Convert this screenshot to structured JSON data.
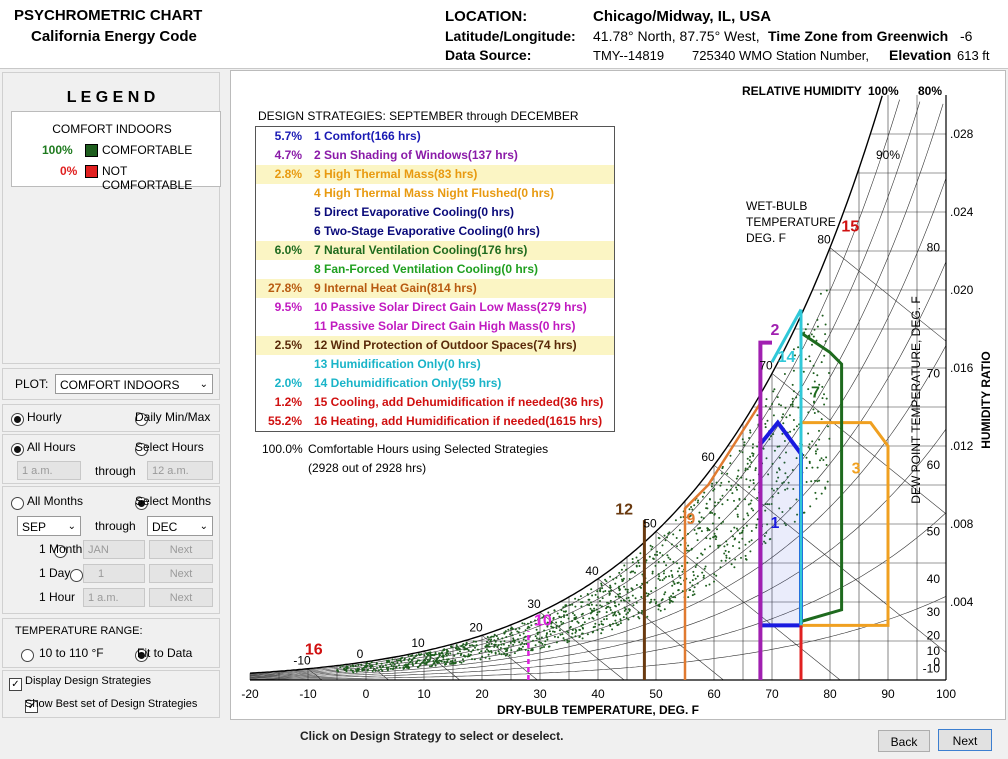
{
  "header": {
    "title1": "PSYCHROMETRIC CHART",
    "title2": "California Energy Code",
    "location_label": "LOCATION:",
    "location_value": "Chicago/Midway, IL, USA",
    "latlon_label": "Latitude/Longitude:",
    "latlon_value": "41.78° North, 87.75° West,",
    "tz_label": "Time Zone from Greenwich",
    "tz_value": "-6",
    "source_label": "Data Source:",
    "source_value": "TMY--14819",
    "wmo_value": "725340 WMO Station Number,",
    "elev_label": "Elevation",
    "elev_value": "613 ft"
  },
  "legend": {
    "title": "L E G E N D",
    "subtitle": "COMFORT INDOORS",
    "items": [
      {
        "pct": "100%",
        "label": "COMFORTABLE",
        "color": "#1e5e1e"
      },
      {
        "pct": "0%",
        "label": "NOT COMFORTABLE",
        "color": "#e02020"
      }
    ]
  },
  "controls": {
    "plot_label": "PLOT:",
    "plot_value": "COMFORT INDOORS",
    "hourly": "Hourly",
    "daily": "Daily Min/Max",
    "all_hours": "All Hours",
    "select_hours": "Select Hours",
    "hour_from": "1 a.m.",
    "through": "through",
    "hour_to": "12 a.m.",
    "all_months": "All Months",
    "select_months": "Select Months",
    "month_from": "SEP",
    "month_to": "DEC",
    "one_month": "1 Month",
    "one_month_val": "JAN",
    "one_day": "1 Day",
    "one_day_val": "1",
    "one_hour": "1 Hour",
    "one_hour_val": "1 a.m.",
    "next": "Next",
    "temp_range": "TEMPERATURE RANGE:",
    "range_a": "10 to 110 °F",
    "range_b": "Fit to Data",
    "display_strategies": "Display Design Strategies",
    "best_set": "Show Best set of Design Strategies"
  },
  "strategies_title": "DESIGN STRATEGIES:  SEPTEMBER through DECEMBER",
  "strategies": [
    {
      "pct": "5.7%",
      "num": "1",
      "label": "Comfort(166 hrs)",
      "color": "#1a1ab4",
      "hl": false
    },
    {
      "pct": "4.7%",
      "num": "2",
      "label": "Sun Shading of Windows(137 hrs)",
      "color": "#8a1aa8",
      "hl": false
    },
    {
      "pct": "2.8%",
      "num": "3",
      "label": "High Thermal Mass(83 hrs)",
      "color": "#e89a10",
      "hl": true
    },
    {
      "pct": "",
      "num": "4",
      "label": "High Thermal Mass Night Flushed(0 hrs)",
      "color": "#e89a10",
      "hl": false
    },
    {
      "pct": "",
      "num": "5",
      "label": "Direct Evaporative Cooling(0 hrs)",
      "color": "#0a0a7a",
      "hl": false
    },
    {
      "pct": "",
      "num": "6",
      "label": "Two-Stage Evaporative Cooling(0 hrs)",
      "color": "#0a0a7a",
      "hl": false
    },
    {
      "pct": "6.0%",
      "num": "7",
      "label": "Natural Ventilation Cooling(176 hrs)",
      "color": "#1e6a1e",
      "hl": true
    },
    {
      "pct": "",
      "num": "8",
      "label": "Fan-Forced Ventilation Cooling(0 hrs)",
      "color": "#20a020",
      "hl": false
    },
    {
      "pct": "27.8%",
      "num": "9",
      "label": "Internal Heat Gain(814 hrs)",
      "color": "#b85a10",
      "hl": true
    },
    {
      "pct": "9.5%",
      "num": "10",
      "label": "Passive Solar Direct Gain Low Mass(279 hrs)",
      "color": "#c01ac0",
      "hl": false
    },
    {
      "pct": "",
      "num": "11",
      "label": "Passive Solar Direct Gain High Mass(0 hrs)",
      "color": "#c01ac0",
      "hl": false
    },
    {
      "pct": "2.5%",
      "num": "12",
      "label": "Wind Protection of Outdoor Spaces(74 hrs)",
      "color": "#5a2a0a",
      "hl": true
    },
    {
      "pct": "",
      "num": "13",
      "label": "Humidification Only(0 hrs)",
      "color": "#1ab4c8",
      "hl": false
    },
    {
      "pct": "2.0%",
      "num": "14",
      "label": "Dehumidification Only(59 hrs)",
      "color": "#1ab4c8",
      "hl": false
    },
    {
      "pct": "1.2%",
      "num": "15",
      "label": "Cooling, add Dehumidification if needed(36 hrs)",
      "color": "#d01010",
      "hl": false
    },
    {
      "pct": "55.2%",
      "num": "16",
      "label": "Heating, add Humidification if needed(1615 hrs)",
      "color": "#d01010",
      "hl": false
    }
  ],
  "comfort_summary": {
    "pct": "100.0%",
    "line1": "Comfortable Hours using Selected Strategies",
    "line2": "(2928 out of 2928 hrs)"
  },
  "chart_data": {
    "type": "scatter",
    "xlabel": "DRY-BULB TEMPERATURE, DEG. F",
    "ylabel_right": "HUMIDITY RATIO",
    "dewpoint_label": "DEW POINT TEMPERATURE, DEG. F",
    "wetbulb_label": [
      "WET-BULB",
      "TEMPERATURE",
      "DEG. F"
    ],
    "rh_title": "RELATIVE HUMIDITY",
    "rh_labels": [
      "100%",
      "80%",
      "90%"
    ],
    "xlim": [
      -20,
      100
    ],
    "ylim": [
      0,
      0.03
    ],
    "x_ticks": [
      "-20",
      "-10",
      "0",
      "10",
      "20",
      "30",
      "40",
      "50",
      "60",
      "70",
      "80",
      "90",
      "100"
    ],
    "y_ticks": [
      ".004",
      ".008",
      ".012",
      ".016",
      ".020",
      ".024",
      ".028"
    ],
    "dewpoint_ticks": [
      "80",
      "70",
      "60",
      "50",
      "40",
      "30",
      "20",
      "10",
      "0",
      "-10"
    ],
    "wetbulb_ticks": [
      "-10",
      "0",
      "10",
      "20",
      "30",
      "40",
      "50",
      "60",
      "70",
      "80"
    ],
    "strategy_labels": [
      "1",
      "2",
      "3",
      "7",
      "9",
      "10",
      "12",
      "14",
      "15",
      "16"
    ],
    "comfort_zone_1": [
      [
        68,
        0.0028
      ],
      [
        75,
        0.0028
      ],
      [
        75,
        0.0116
      ],
      [
        71,
        0.0132
      ],
      [
        68,
        0.0121
      ]
    ],
    "zone_3": [
      [
        75,
        0.0028
      ],
      [
        90,
        0.0028
      ],
      [
        90,
        0.012
      ],
      [
        87,
        0.0132
      ],
      [
        75,
        0.0132
      ]
    ],
    "zone_7": [
      [
        75,
        0.003
      ],
      [
        82,
        0.0036
      ],
      [
        82,
        0.0162
      ],
      [
        80,
        0.0168
      ],
      [
        75,
        0.0178
      ]
    ],
    "zone_9": [
      [
        55,
        0.0
      ],
      [
        55,
        0.0088
      ],
      [
        59,
        0.01
      ],
      [
        68,
        0.0142
      ],
      [
        68,
        0.0
      ]
    ],
    "zone_14": [
      [
        75,
        0.019
      ],
      [
        70,
        0.0163
      ]
    ],
    "line_2": [
      [
        68,
        0.0
      ],
      [
        68,
        0.0173
      ],
      [
        70,
        0.0173
      ]
    ],
    "line_12": [
      [
        48,
        0.0
      ],
      [
        48,
        0.0082
      ]
    ],
    "line_10": [
      [
        28,
        0.0
      ],
      [
        28,
        0.0025
      ]
    ],
    "line_15": [
      [
        75,
        0.0
      ],
      [
        75,
        0.0028
      ]
    ]
  }
}
